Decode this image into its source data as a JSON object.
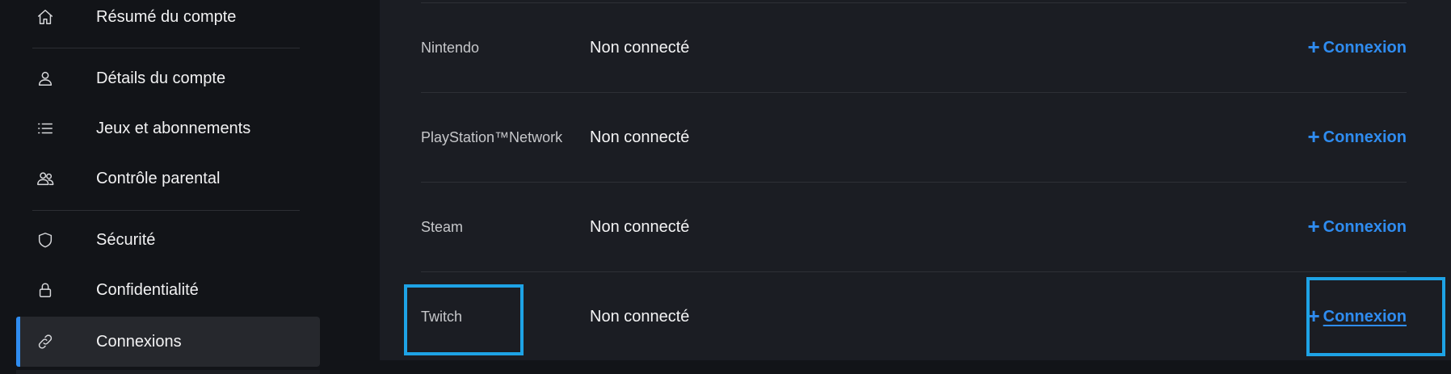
{
  "sidebar": {
    "items": [
      {
        "label": "Résumé du compte",
        "icon": "home-icon"
      },
      {
        "label": "Détails du compte",
        "icon": "user-icon"
      },
      {
        "label": "Jeux et abonnements",
        "icon": "list-icon"
      },
      {
        "label": "Contrôle parental",
        "icon": "users-icon"
      },
      {
        "label": "Sécurité",
        "icon": "shield-icon"
      },
      {
        "label": "Confidentialité",
        "icon": "lock-icon"
      },
      {
        "label": "Connexions",
        "icon": "link-icon",
        "active": true
      }
    ]
  },
  "connections": {
    "rows": [
      {
        "service": "Nintendo",
        "status": "Non connecté",
        "action": "Connexion"
      },
      {
        "service": "PlayStation™Network",
        "status": "Non connecté",
        "action": "Connexion"
      },
      {
        "service": "Steam",
        "status": "Non connecté",
        "action": "Connexion"
      },
      {
        "service": "Twitch",
        "status": "Non connecté",
        "action": "Connexion"
      }
    ]
  },
  "colors": {
    "accent": "#2f8cf0",
    "highlight": "#1ea3e6",
    "panel_bg": "#1b1d23",
    "page_bg": "#121418"
  }
}
